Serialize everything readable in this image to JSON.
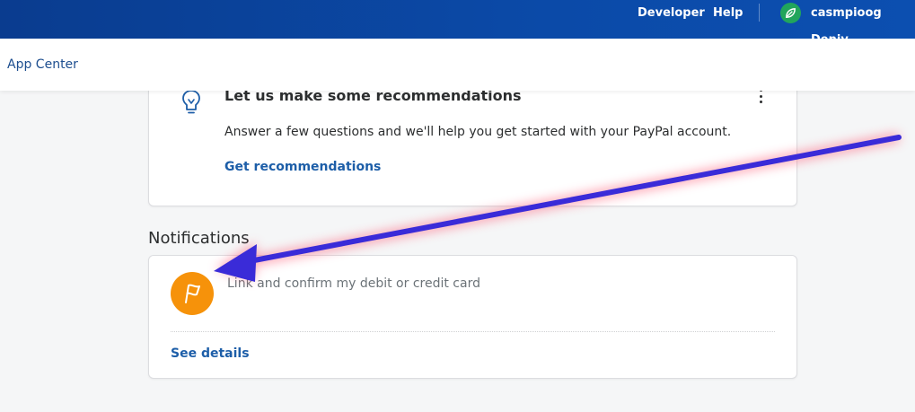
{
  "topbar": {
    "developer_label": "Developer",
    "help_label": "Help",
    "user_name": "casmpioog Deniy",
    "background": "#0b4aa8"
  },
  "subheader": {
    "title": "App Center"
  },
  "recommendations": {
    "title": "Let us make some recommendations",
    "description": "Answer a few questions and we'll help you get started with your PayPal account.",
    "link_label": "Get recommendations",
    "icon": "lightbulb-icon",
    "menu_icon": "more-vertical-icon"
  },
  "notifications": {
    "heading": "Notifications",
    "item_text": "Link and confirm my debit or credit card",
    "link_label": "See details",
    "icon": "flag-icon",
    "icon_color": "#f6920a"
  },
  "annotation": {
    "type": "arrow",
    "color": "#3a2bd8",
    "glow_color": "#ff4d6a"
  }
}
